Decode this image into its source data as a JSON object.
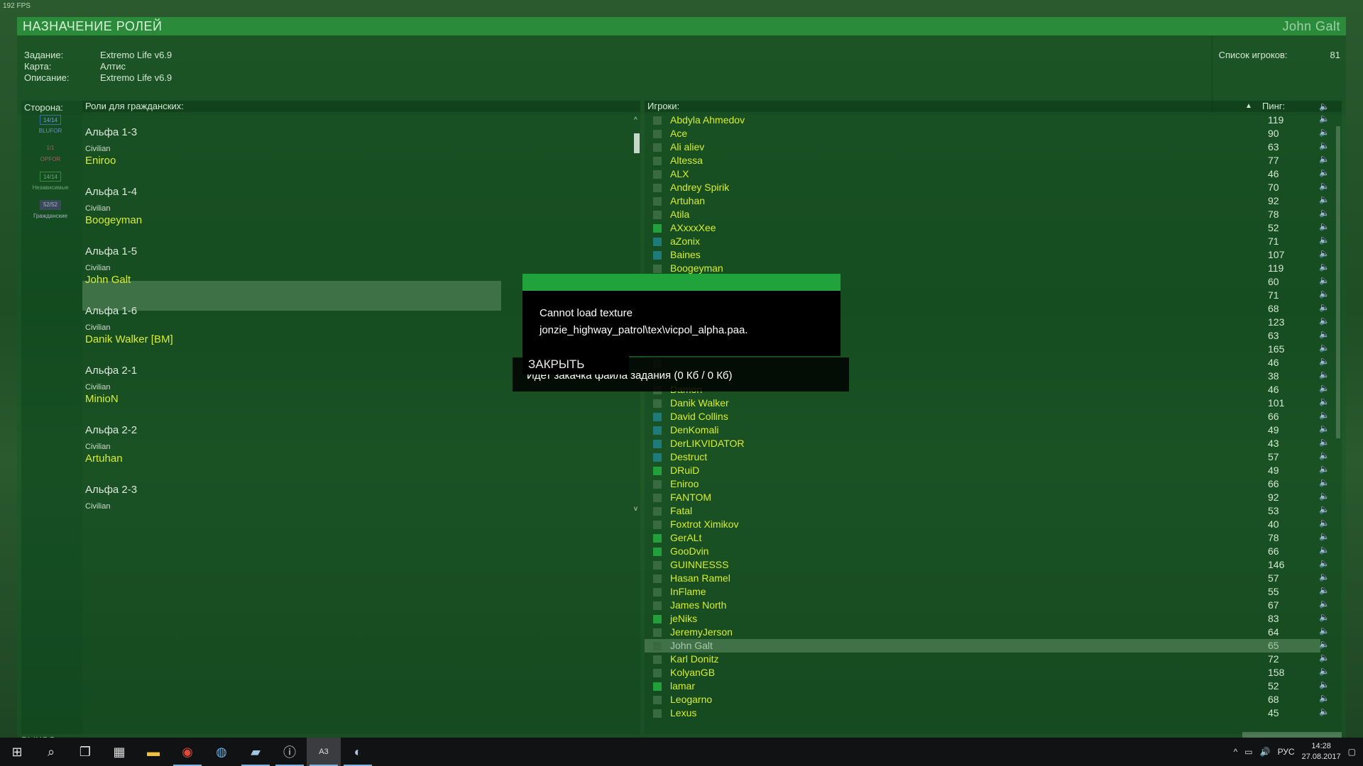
{
  "fps": "192 FPS",
  "header": {
    "title": "НАЗНАЧЕНИЕ РОЛЕЙ",
    "user": "John Galt"
  },
  "info": {
    "mission_label": "Задание:",
    "mission_value": "Extremo Life v6.9",
    "map_label": "Карта:",
    "map_value": "Алтис",
    "desc_label": "Описание:",
    "desc_value": "Extremo Life v6.9",
    "playerlist_label": "Список игроков:",
    "playerlist_count": "81"
  },
  "sides": {
    "header": "Сторона:",
    "items": [
      {
        "count": "14/14",
        "name": "BLUFOR"
      },
      {
        "count": "1/1",
        "name": "OPFOR"
      },
      {
        "count": "14/14",
        "name": "Независимые"
      },
      {
        "count": "52/52",
        "name": "Гражданские"
      }
    ]
  },
  "roles": {
    "header": "Роли для гражданских:",
    "groups": [
      {
        "title": "Альфа 1-3",
        "sub": "Civilian",
        "name": "Eniroo"
      },
      {
        "title": "Альфа 1-4",
        "sub": "Civilian",
        "name": "Boogeyman"
      },
      {
        "title": "Альфа 1-5",
        "sub": "Civilian",
        "name": "John Galt"
      },
      {
        "title": "Альфа 1-6",
        "sub": "Civilian",
        "name": "Danik Walker [BM]"
      },
      {
        "title": "Альфа 2-1",
        "sub": "Civilian",
        "name": "MinioN"
      },
      {
        "title": "Альфа 2-2",
        "sub": "Civilian",
        "name": "Artuhan"
      },
      {
        "title": "Альфа 2-3",
        "sub": "Civilian",
        "name": ""
      }
    ]
  },
  "players": {
    "header": "Игроки:",
    "ping_header": "Пинг:",
    "rows": [
      {
        "name": "Abdyla Ahmedov",
        "ping": "119",
        "color": "#3a6a3f"
      },
      {
        "name": "Ace",
        "ping": "90",
        "color": "#3a6a3f"
      },
      {
        "name": "Ali aliev",
        "ping": "63",
        "color": "#3a6a3f"
      },
      {
        "name": "Altessa",
        "ping": "77",
        "color": "#3a6a3f"
      },
      {
        "name": "ALX",
        "ping": "46",
        "color": "#3a6a3f"
      },
      {
        "name": "Andrey Spirik",
        "ping": "70",
        "color": "#3a6a3f"
      },
      {
        "name": "Artuhan",
        "ping": "92",
        "color": "#3a6a3f"
      },
      {
        "name": "Atila",
        "ping": "78",
        "color": "#3a6a3f"
      },
      {
        "name": "AXxxxXee",
        "ping": "52",
        "color": "#23a03c"
      },
      {
        "name": "aZonix",
        "ping": "71",
        "color": "#1f7a7a"
      },
      {
        "name": "Baines",
        "ping": "107",
        "color": "#1f7a7a"
      },
      {
        "name": "Boogeyman",
        "ping": "119",
        "color": "#3a6a3f"
      },
      {
        "name": "",
        "ping": "60",
        "color": "#3a6a3f"
      },
      {
        "name": "",
        "ping": "71",
        "color": "#3a6a3f"
      },
      {
        "name": "",
        "ping": "68",
        "color": "#3a6a3f"
      },
      {
        "name": "",
        "ping": "123",
        "color": "#3a6a3f"
      },
      {
        "name": "",
        "ping": "63",
        "color": "#3a6a3f"
      },
      {
        "name": "",
        "ping": "165",
        "color": "#3a6a3f"
      },
      {
        "name": "",
        "ping": "46",
        "color": "#3a6a3f"
      },
      {
        "name": "",
        "ping": "38",
        "color": "#3a6a3f"
      },
      {
        "name": "Damon",
        "ping": "46",
        "color": "#3a6a3f"
      },
      {
        "name": "Danik Walker",
        "ping": "101",
        "color": "#3a6a3f"
      },
      {
        "name": "David Collins",
        "ping": "66",
        "color": "#1f7a7a"
      },
      {
        "name": "DenKomali",
        "ping": "49",
        "color": "#1f7a7a"
      },
      {
        "name": "DerLIKVIDATOR",
        "ping": "43",
        "color": "#1f7a7a"
      },
      {
        "name": "Destruct",
        "ping": "57",
        "color": "#1f7a7a"
      },
      {
        "name": "DRuiD",
        "ping": "49",
        "color": "#23a03c"
      },
      {
        "name": "Eniroo",
        "ping": "66",
        "color": "#3a6a3f"
      },
      {
        "name": "FANTOM",
        "ping": "92",
        "color": "#3a6a3f"
      },
      {
        "name": "Fatal",
        "ping": "53",
        "color": "#3a6a3f"
      },
      {
        "name": "Foxtrot Ximikov",
        "ping": "40",
        "color": "#3a6a3f"
      },
      {
        "name": "GerALt",
        "ping": "78",
        "color": "#23a03c"
      },
      {
        "name": "GooDvin",
        "ping": "66",
        "color": "#23a03c"
      },
      {
        "name": "GUINNESSS",
        "ping": "146",
        "color": "#3a6a3f"
      },
      {
        "name": "Hasan Ramel",
        "ping": "57",
        "color": "#3a6a3f"
      },
      {
        "name": "InFlame",
        "ping": "55",
        "color": "#3a6a3f"
      },
      {
        "name": "James North",
        "ping": "67",
        "color": "#3a6a3f"
      },
      {
        "name": "jeNiks",
        "ping": "83",
        "color": "#23a03c"
      },
      {
        "name": "JeremyJerson",
        "ping": "64",
        "color": "#3a6a3f"
      },
      {
        "name": "John Galt",
        "ping": "65",
        "color": "#3a6a3f"
      },
      {
        "name": "Karl Donitz",
        "ping": "72",
        "color": "#3a6a3f"
      },
      {
        "name": "KolyanGB",
        "ping": "158",
        "color": "#3a6a3f"
      },
      {
        "name": "lamar",
        "ping": "52",
        "color": "#23a03c"
      },
      {
        "name": "Leogarno",
        "ping": "68",
        "color": "#3a6a3f"
      },
      {
        "name": "Lexus",
        "ping": "45",
        "color": "#3a6a3f"
      }
    ]
  },
  "dialog": {
    "line1": "Cannot load texture",
    "line2": "jonzie_highway_patrol\\tex\\vicpol_alpha.paa.",
    "close": "ЗАКРЫТЬ",
    "progress": "Идет закачка файла задания (0 Кб / 0 Кб)"
  },
  "bottom": {
    "left": "ВЫХОД"
  },
  "taskbar": {
    "lang": "РУС",
    "time": "14:28",
    "date": "27.08.2017",
    "apps": [
      "start-icon",
      "search-icon",
      "task-view-icon",
      "calculator-icon",
      "file-explorer-icon",
      "chrome-icon",
      "edge-icon",
      "notepad-icon",
      "info-icon",
      "arma-icon",
      "steam-icon"
    ]
  }
}
